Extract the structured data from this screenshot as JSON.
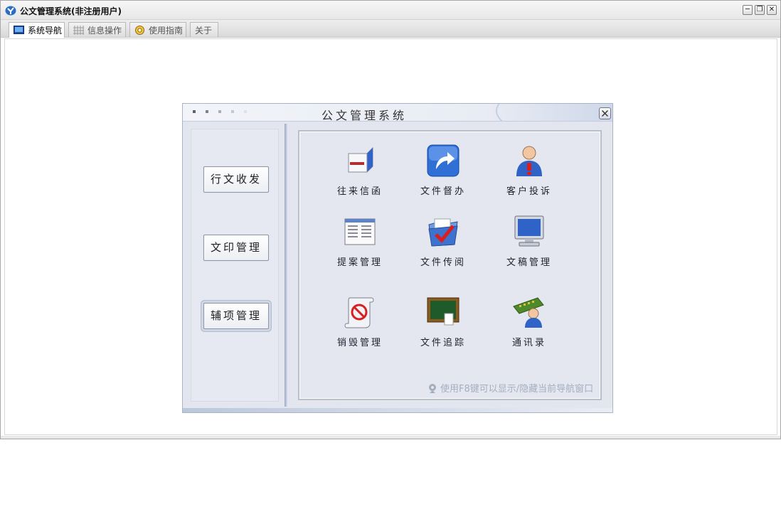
{
  "window": {
    "title": "公文管理系统(非注册用户)",
    "minimize_label": "─",
    "restore_label": "❐",
    "close_label": "✕"
  },
  "tabs": [
    {
      "label": "系统导航",
      "icon": "monitor-icon",
      "active": true
    },
    {
      "label": "信息操作",
      "icon": "grid-icon",
      "active": false
    },
    {
      "label": "使用指南",
      "icon": "lifebuoy-icon",
      "active": false
    },
    {
      "label": "关于",
      "icon": "",
      "active": false
    }
  ],
  "nav_dialog": {
    "title": "公文管理系统",
    "side_buttons": [
      {
        "label": "行文收发",
        "selected": false
      },
      {
        "label": "文印管理",
        "selected": false
      },
      {
        "label": "辅项管理",
        "selected": true
      }
    ],
    "items": [
      {
        "label": "往来信函",
        "icon": "letter-box-icon"
      },
      {
        "label": "文件督办",
        "icon": "forward-arrow-icon"
      },
      {
        "label": "客户投诉",
        "icon": "person-alert-icon"
      },
      {
        "label": "提案管理",
        "icon": "document-list-icon"
      },
      {
        "label": "文件传阅",
        "icon": "folder-check-icon"
      },
      {
        "label": "文稿管理",
        "icon": "computer-monitor-icon"
      },
      {
        "label": "销毁管理",
        "icon": "scroll-prohibited-icon"
      },
      {
        "label": "文件追踪",
        "icon": "chalkboard-icon"
      },
      {
        "label": "通讯录",
        "icon": "contacts-card-icon"
      }
    ],
    "hint": "使用F8键可以显示/隐藏当前导航窗口"
  },
  "colors": {
    "accent_blue": "#2f6fd6",
    "panel_bg": "#e4e7ef",
    "hint_text": "#a5aebf"
  }
}
